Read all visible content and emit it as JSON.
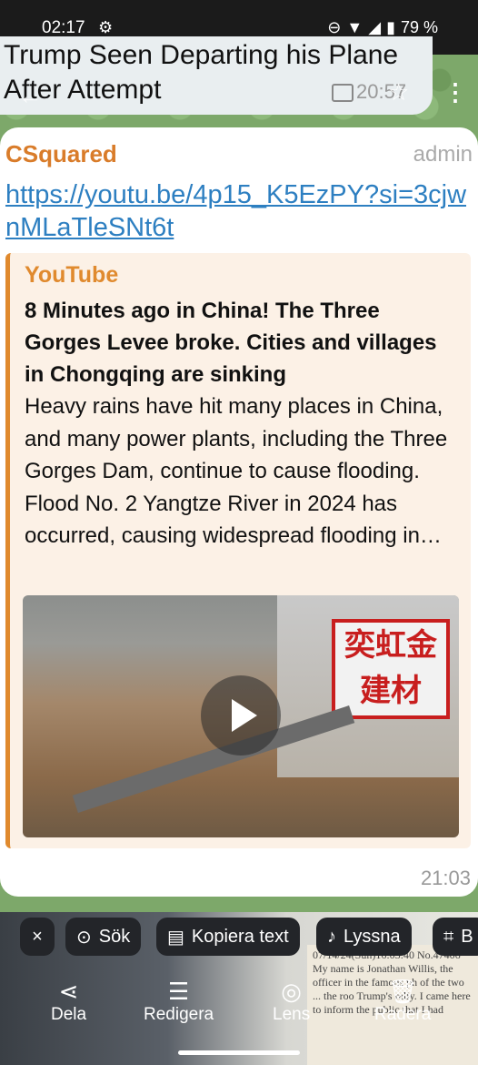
{
  "status_bar": {
    "time": "02:17",
    "battery": "79 %"
  },
  "top_message": {
    "title": "Trump Seen Departing his Plane After Attempt",
    "time": "20:57"
  },
  "message": {
    "sender": "CSquared",
    "role": "admin",
    "link": "https://youtu.be/4p15_K5EzPY?si=3cjwnMLaTleSNt6t",
    "time": "21:03",
    "preview": {
      "site": "YouTube",
      "title": "8 Minutes ago in China! The Three Gorges Levee broke. Cities and villages in Chongqing are sinking",
      "description": "Heavy rains have hit many places in China, and many power plants, including the Three Gorges Dam, continue to cause flooding. Flood No. 2 Yangtze River in 2024 has occurred, causing widespread flooding in…",
      "image_sign_text": "奕虹金建材"
    }
  },
  "lens_toolbar": {
    "close_label": "×",
    "search_label": "Sök",
    "copy_text_label": "Kopiera text",
    "listen_label": "Lyssna",
    "crop_label": "B"
  },
  "bottom_actions": {
    "share_label": "Dela",
    "edit_label": "Redigera",
    "lens_label": "Lens",
    "delete_label": "Radera"
  },
  "background_doc": {
    "header": "07/14/24(Sun)16:03:40 No.47406",
    "text": "My name is Jonathan Willis, the officer in the famous ph of the two ... the roo Trump's rally. I came here to inform the public that I had"
  }
}
